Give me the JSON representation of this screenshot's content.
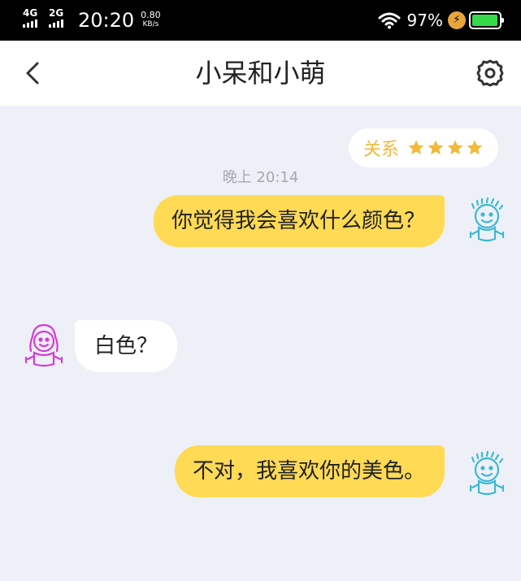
{
  "status_bar": {
    "network_1": "4G",
    "network_2": "2G",
    "time": "20:20",
    "speed_value": "0.80",
    "speed_unit": "KB/s",
    "battery_percent": "97%",
    "battery_level": 0.97,
    "charging_icon": "lightning-icon",
    "wifi_icon": "wifi-icon"
  },
  "header": {
    "back_icon": "chevron-left-icon",
    "title": "小呆和小萌",
    "settings_icon": "gear-icon"
  },
  "chat": {
    "relation": {
      "label": "关系",
      "stars": 4,
      "star_color": "#f3b93a"
    },
    "timestamp": "晚上 20:14",
    "messages": [
      {
        "sender": "me",
        "text": "你觉得我会喜欢什么颜色？",
        "avatar": "blue-boy-avatar"
      },
      {
        "sender": "them",
        "text": "白色？",
        "avatar": "pink-girl-avatar"
      },
      {
        "sender": "me",
        "text": "不对，我喜欢你的美色。",
        "avatar": "blue-boy-avatar"
      }
    ]
  },
  "colors": {
    "my_bubble": "#ffda55",
    "their_bubble": "#ffffff",
    "background": "#eef0f7",
    "my_avatar": "#3bb9d3",
    "their_avatar": "#d63bd9"
  }
}
